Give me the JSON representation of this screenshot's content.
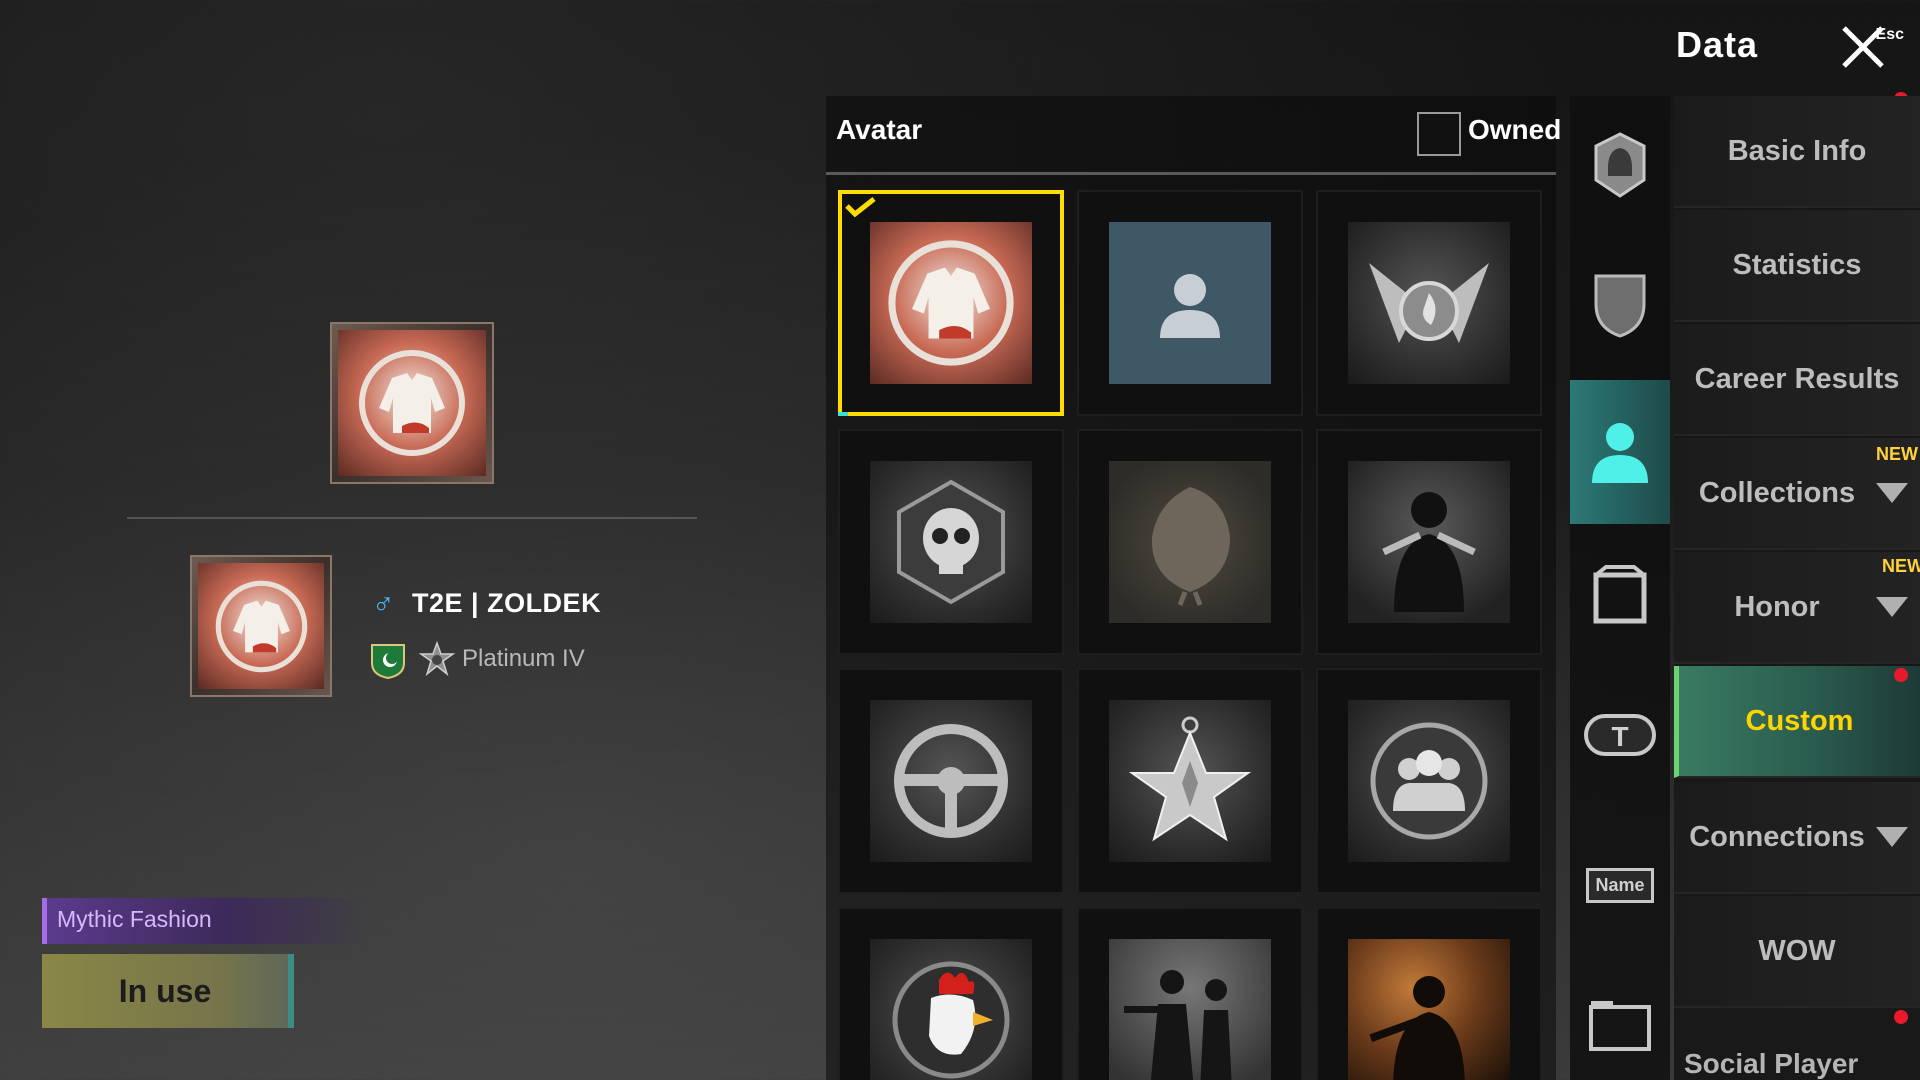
{
  "window": {
    "title": "Data",
    "close_hint": "Esc"
  },
  "player": {
    "name": "T2E | ZOLDEK",
    "gender_symbol": "♂",
    "rank": "Platinum IV",
    "flag_color": "#1f7a3a",
    "item_rarity": "Mythic Fashion",
    "status_button": "In use"
  },
  "avatar_panel": {
    "header": "Avatar",
    "filter_label": "Owned",
    "filter_checked": false,
    "items": [
      {
        "icon": "jacket-icon",
        "selected": true
      },
      {
        "icon": "default-person-icon",
        "selected": false
      },
      {
        "icon": "winged-flame-emblem-icon",
        "selected": false
      },
      {
        "icon": "skull-hexagon-icon",
        "selected": false
      },
      {
        "icon": "chicken-silhouette-icon",
        "selected": false
      },
      {
        "icon": "gunslinger-icon",
        "selected": false
      },
      {
        "icon": "steering-wheel-icon",
        "selected": false
      },
      {
        "icon": "star-medal-icon",
        "selected": false
      },
      {
        "icon": "squad-emblem-icon",
        "selected": false
      },
      {
        "icon": "rooster-emblem-icon",
        "selected": false
      },
      {
        "icon": "duo-agents-icon",
        "selected": false
      },
      {
        "icon": "soldier-fire-icon",
        "selected": false
      }
    ]
  },
  "tabs": [
    {
      "icon": "helmet-emblem-icon",
      "active": false
    },
    {
      "icon": "shield-icon",
      "active": false
    },
    {
      "icon": "avatar-person-icon",
      "active": true
    },
    {
      "icon": "frame-icon",
      "active": false
    },
    {
      "icon": "title-badge-icon",
      "active": false
    },
    {
      "icon": "name-tag-icon",
      "active": false,
      "text": "Name"
    },
    {
      "icon": "card-frame-icon",
      "active": false
    }
  ],
  "menu": {
    "items": [
      {
        "label": "Basic Info",
        "active": false,
        "has_dropdown": false,
        "new": false
      },
      {
        "label": "Statistics",
        "active": false,
        "has_dropdown": false,
        "new": false
      },
      {
        "label": "Career Results",
        "active": false,
        "has_dropdown": false,
        "new": false
      },
      {
        "label": "Collections",
        "active": false,
        "has_dropdown": true,
        "new": true
      },
      {
        "label": "Honor",
        "active": false,
        "has_dropdown": true,
        "new": true
      },
      {
        "label": "Custom",
        "active": true,
        "has_dropdown": false,
        "new": false
      },
      {
        "label": "Connections",
        "active": false,
        "has_dropdown": true,
        "new": false
      },
      {
        "label": "WOW",
        "active": false,
        "has_dropdown": false,
        "new": false
      }
    ],
    "new_badge": "NEW",
    "cut_off_label": "Social Player Card"
  },
  "colors": {
    "accent_yellow": "#ffdd00",
    "active_tab_teal": "#2c7a78",
    "active_menu_green": "#3a7b62",
    "notification_red": "#e8192c"
  }
}
